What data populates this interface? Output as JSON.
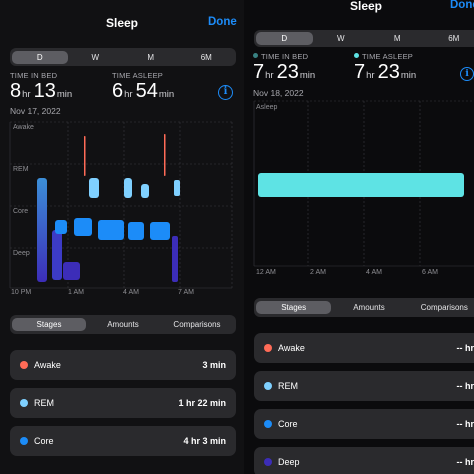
{
  "colors": {
    "awake": "#ff6b57",
    "rem": "#7fd0ff",
    "core": "#1c8cf8",
    "deep": "#3c2db8",
    "asleep": "#5ee3e4",
    "accent": "#1d8cf8"
  },
  "left": {
    "nav": {
      "title": "Sleep",
      "done": "Done"
    },
    "period_tabs": [
      "D",
      "W",
      "M",
      "6M"
    ],
    "time_in_bed": {
      "label": "TIME IN BED",
      "hours": "8",
      "hr_unit": "hr",
      "minutes": "13",
      "min_unit": "min"
    },
    "time_asleep": {
      "label": "TIME ASLEEP",
      "hours": "6",
      "hr_unit": "hr",
      "minutes": "54",
      "min_unit": "min"
    },
    "date": "Nov 17, 2022",
    "info_icon": "info-icon",
    "stage_labels": [
      "Awake",
      "REM",
      "Core",
      "Deep"
    ],
    "time_ticks": [
      "10 PM",
      "1 AM",
      "4 AM",
      "7 AM"
    ],
    "view_tabs": [
      "Stages",
      "Amounts",
      "Comparisons"
    ],
    "rows": [
      {
        "label": "Awake",
        "value": "3 min",
        "color_key": "awake"
      },
      {
        "label": "REM",
        "value": "1 hr 22 min",
        "color_key": "rem"
      },
      {
        "label": "Core",
        "value": "4 hr 3 min",
        "color_key": "core"
      }
    ]
  },
  "right": {
    "nav": {
      "title": "Sleep",
      "done": "Done"
    },
    "period_tabs": [
      "D",
      "W",
      "M",
      "6M"
    ],
    "time_in_bed": {
      "label": "TIME IN BED",
      "hours": "7",
      "hr_unit": "hr",
      "minutes": "23",
      "min_unit": "min"
    },
    "time_asleep": {
      "label": "TIME ASLEEP",
      "hours": "7",
      "hr_unit": "hr",
      "minutes": "23",
      "min_unit": "min"
    },
    "date": "Nov 18, 2022",
    "info_icon": "info-icon",
    "chart_label": "Asleep",
    "time_ticks": [
      "12 AM",
      "2 AM",
      "4 AM",
      "6 AM"
    ],
    "view_tabs": [
      "Stages",
      "Amounts",
      "Comparisons"
    ],
    "rows": [
      {
        "label": "Awake",
        "value": "-- hr",
        "color_key": "awake"
      },
      {
        "label": "REM",
        "value": "-- hr",
        "color_key": "rem"
      },
      {
        "label": "Core",
        "value": "-- hr",
        "color_key": "core"
      },
      {
        "label": "Deep",
        "value": "-- hr",
        "color_key": "deep"
      }
    ]
  }
}
